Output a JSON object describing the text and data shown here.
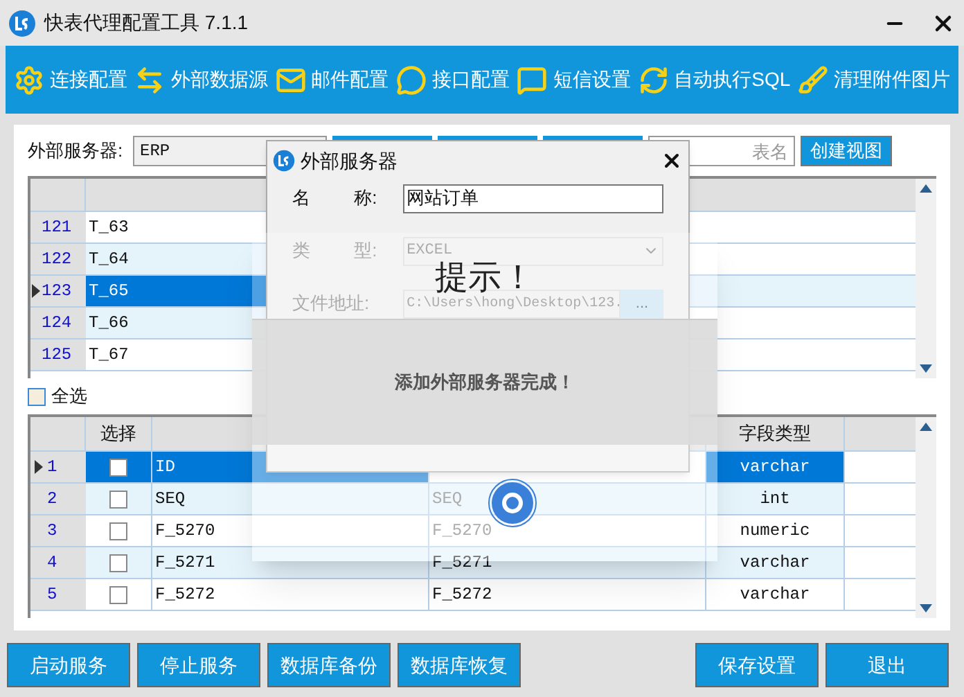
{
  "window": {
    "title": "快表代理配置工具 7.1.1"
  },
  "toolbar": [
    {
      "label": "连接配置",
      "kind": "connect"
    },
    {
      "label": "外部数据源",
      "kind": "source"
    },
    {
      "label": "邮件配置",
      "kind": "mail"
    },
    {
      "label": "接口配置",
      "kind": "chat"
    },
    {
      "label": "短信设置",
      "kind": "sms"
    },
    {
      "label": "自动执行SQL",
      "kind": "refresh"
    },
    {
      "label": "清理附件图片",
      "kind": "broom"
    }
  ],
  "server_bar": {
    "label": "外部服务器:",
    "select_value": "ERP",
    "search_placeholder": "表名",
    "create_button": "创建视图"
  },
  "tables_grid": {
    "rows": [
      {
        "number": "121",
        "name": "T_63",
        "selected": false
      },
      {
        "number": "122",
        "name": "T_64",
        "selected": false
      },
      {
        "number": "123",
        "name": "T_65",
        "selected": true
      },
      {
        "number": "124",
        "name": "T_66",
        "selected": false
      },
      {
        "number": "125",
        "name": "T_67",
        "selected": false
      }
    ]
  },
  "select_all": {
    "label": "全选",
    "checked": false
  },
  "fields_grid": {
    "column_2": "选择",
    "column_5": "字段类型",
    "rows": [
      {
        "number": "1",
        "checked": false,
        "column_3": "ID",
        "type": "varchar",
        "selected": true
      },
      {
        "number": "2",
        "checked": false,
        "column_3": "SEQ",
        "column_4": "SEQ",
        "type": "int",
        "selected": false
      },
      {
        "number": "3",
        "checked": false,
        "column_3": "F_5270",
        "column_4": "F_5270",
        "type": "numeric",
        "selected": false
      },
      {
        "number": "4",
        "checked": false,
        "column_3": "F_5271",
        "column_4": "F_5271",
        "type": "varchar",
        "selected": false
      },
      {
        "number": "5",
        "checked": false,
        "column_3": "F_5272",
        "column_4": "F_5272",
        "type": "varchar",
        "selected": false
      }
    ]
  },
  "bottom_buttons_left": [
    "启动服务",
    "停止服务",
    "数据库备份",
    "数据库恢复"
  ],
  "bottom_buttons_right": [
    "保存设置",
    "退出"
  ],
  "dialog": {
    "title": "外部服务器",
    "name_label_1": "名",
    "name_label_2": "称:",
    "name_value": "网站订单",
    "type_label_1": "类",
    "type_label_2": "型:",
    "type_value": "EXCEL",
    "path_label": "文件地址:",
    "path_value": "C:\\Users\\hong\\Desktop\\123.",
    "browse_button": "..."
  },
  "popup": {
    "title": "提示！",
    "message": "添加外部服务器完成！"
  }
}
